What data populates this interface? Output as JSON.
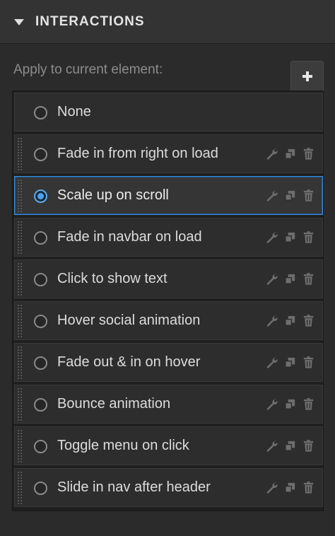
{
  "panel": {
    "title": "INTERACTIONS",
    "collapse_icon": "caret-down-icon"
  },
  "apply": {
    "label": "Apply to current element:",
    "add_icon": "plus-icon"
  },
  "colors": {
    "selected_border": "#3d8fd6",
    "radio_selected": "#4aa3f0",
    "row_bg": "#2d2d2d",
    "panel_bg": "#2b2b2b"
  },
  "interactions": [
    {
      "label": "None",
      "selected": false,
      "has_actions": false
    },
    {
      "label": "Fade in from right on load",
      "selected": false,
      "has_actions": true
    },
    {
      "label": "Scale up on scroll",
      "selected": true,
      "has_actions": true
    },
    {
      "label": "Fade in navbar on load",
      "selected": false,
      "has_actions": true
    },
    {
      "label": "Click to show text",
      "selected": false,
      "has_actions": true
    },
    {
      "label": "Hover social animation",
      "selected": false,
      "has_actions": true
    },
    {
      "label": "Fade out & in on hover",
      "selected": false,
      "has_actions": true
    },
    {
      "label": "Bounce animation",
      "selected": false,
      "has_actions": true
    },
    {
      "label": "Toggle menu on click",
      "selected": false,
      "has_actions": true
    },
    {
      "label": "Slide in nav after header",
      "selected": false,
      "has_actions": true
    }
  ],
  "row_action_icons": [
    "wrench-icon",
    "duplicate-icon",
    "trash-icon"
  ]
}
